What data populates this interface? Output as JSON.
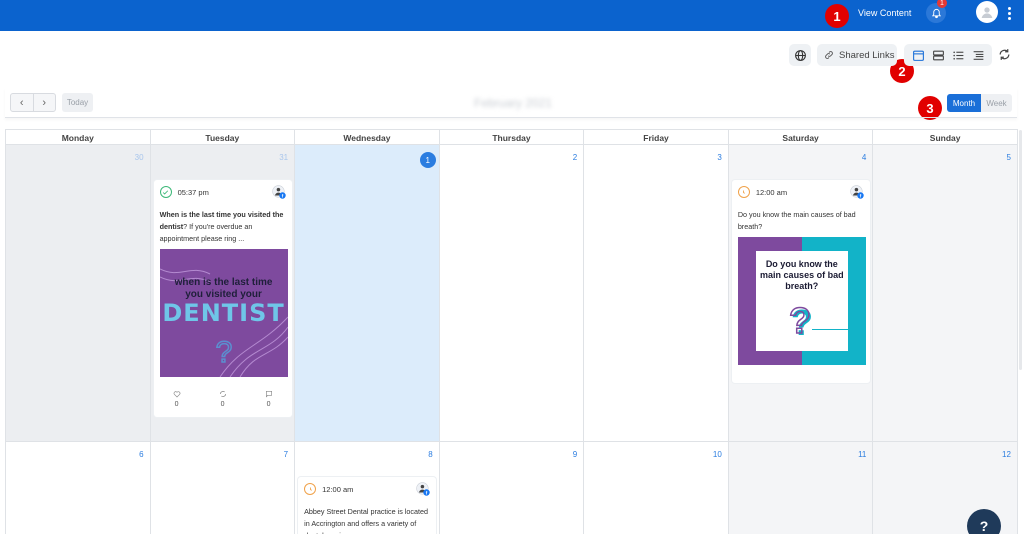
{
  "topbar": {
    "view_content": "View Content",
    "notification_count": "1"
  },
  "annotations": [
    "1",
    "2",
    "3"
  ],
  "toolbar": {
    "shared_links": "Shared Links"
  },
  "nav": {
    "today": "Today",
    "month_title": "February 2021",
    "month": "Month",
    "week": "Week"
  },
  "weekdays": [
    "Monday",
    "Tuesday",
    "Wednesday",
    "Thursday",
    "Friday",
    "Saturday",
    "Sunday"
  ],
  "week1": [
    "30",
    "31",
    "1",
    "2",
    "3",
    "4",
    "5"
  ],
  "week2": [
    "6",
    "7",
    "8",
    "9",
    "10",
    "11",
    "12"
  ],
  "posts": {
    "tuesday": {
      "time": "05:37 pm",
      "bold_text": "When is the last time you visited the dentist",
      "text": "? If you're overdue an appointment please ring ...",
      "image_line1": "when is the last time",
      "image_line2": "you visited your",
      "image_word": "DENTIST",
      "likes": "0",
      "shares": "0",
      "comments": "0"
    },
    "saturday": {
      "time": "12:00 am",
      "text": "Do you know the main causes of bad breath?",
      "image_text": "Do you know the main causes of bad breath?"
    },
    "wednesday2": {
      "time": "12:00 am",
      "text": "Abbey Street Dental practice is located in Accrington and offers a variety of dental services"
    }
  },
  "help": "?",
  "colors": {
    "primary": "#0b63ce",
    "accent": "#2b7de0",
    "annotation": "#e10000"
  }
}
